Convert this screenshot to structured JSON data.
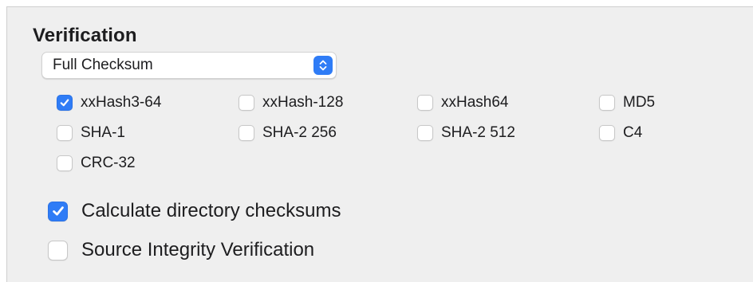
{
  "verification": {
    "title": "Verification",
    "method": {
      "selected": "Full Checksum",
      "stepper_icon": "chevron-up-down-icon"
    },
    "hashes": [
      {
        "label": "xxHash3-64",
        "checked": true
      },
      {
        "label": "xxHash-128",
        "checked": false
      },
      {
        "label": "xxHash64",
        "checked": false
      },
      {
        "label": "MD5",
        "checked": false
      },
      {
        "label": "SHA-1",
        "checked": false
      },
      {
        "label": "SHA-2 256",
        "checked": false
      },
      {
        "label": "SHA-2 512",
        "checked": false
      },
      {
        "label": "C4",
        "checked": false
      },
      {
        "label": "CRC-32",
        "checked": false
      }
    ],
    "options": [
      {
        "label": "Calculate directory checksums",
        "checked": true
      },
      {
        "label": "Source Integrity Verification",
        "checked": false
      }
    ]
  },
  "colors": {
    "accent": "#2f7cf6",
    "panel_background": "#efefef"
  }
}
